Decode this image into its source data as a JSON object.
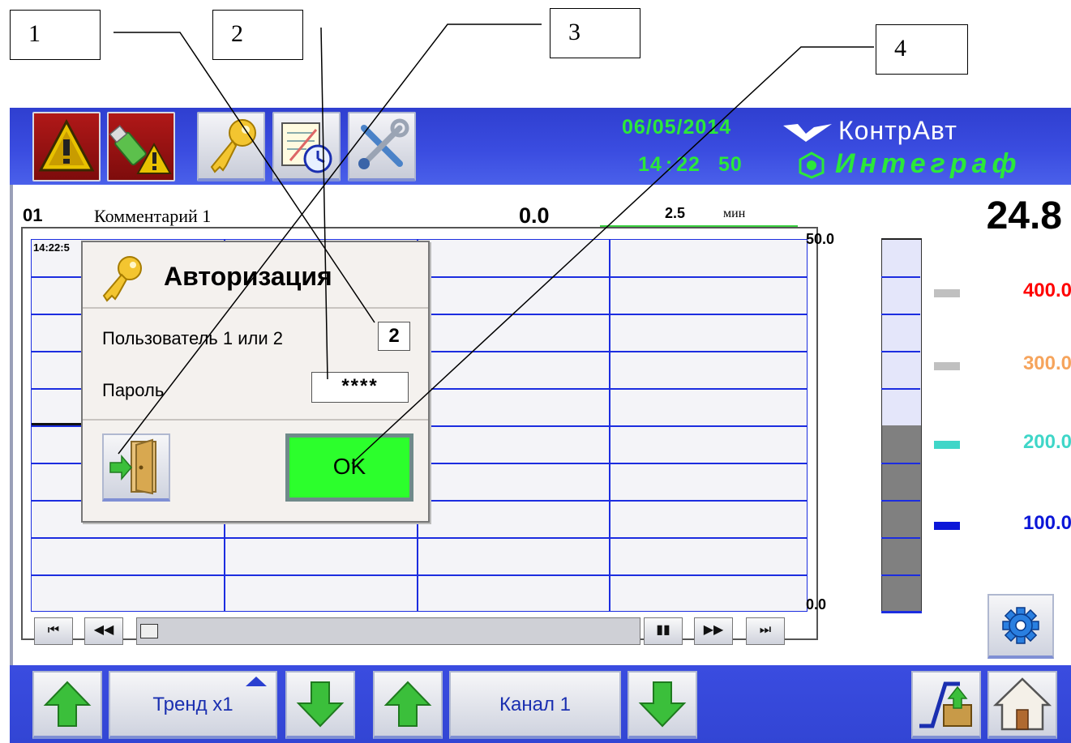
{
  "callouts": {
    "c1": "1",
    "c2": "2",
    "c3": "3",
    "c4": "4"
  },
  "header": {
    "date": "06/05/2014",
    "time_h": "14",
    "time_sep": ":",
    "time_m": "22",
    "time_s": "50",
    "brand_top": "КонтрАвт",
    "brand_bottom": "Интеграф"
  },
  "toolbar": {
    "icons": [
      "alarm-warning-icon",
      "usb-warning-icon",
      "key-icon",
      "notepad-clock-icon",
      "tools-icon"
    ]
  },
  "channel": {
    "number": "01",
    "comment": "Комментарий 1",
    "value_left": "0.0",
    "scale_value": "2.5",
    "scale_unit": "мин",
    "current_value": "24.8",
    "axis_top": "50.0",
    "axis_bottom": "0.0",
    "chart_time": "14:22:5"
  },
  "levels": [
    {
      "value": "400.0",
      "color": "#ff0000",
      "swatch": "#c0c0c0"
    },
    {
      "value": "300.0",
      "color": "#f6a45c",
      "swatch": "#c0c0c0"
    },
    {
      "value": "200.0",
      "color": "#3fd6c8",
      "swatch": "#3fd6c8"
    },
    {
      "value": "100.0",
      "color": "#0b16d8",
      "swatch": "#0b16d8"
    }
  ],
  "bar_level_fraction": 0.5,
  "dialog": {
    "title": "Авторизация",
    "user_label": "Пользователь 1 или 2",
    "user_value": "2",
    "password_label": "Пароль",
    "password_value": "****",
    "ok_label": "OK"
  },
  "playback": {
    "first": "⏮",
    "rewind": "◀◀",
    "pause": "▮▮",
    "forward": "▶▶",
    "last": "⏭"
  },
  "bottom": {
    "trend_label": "Тренд x1",
    "channel_label": "Канал 1"
  },
  "colors": {
    "accent_green": "#2be83a",
    "ok_button": "#2cff2c",
    "bar_fill": "#808080"
  }
}
